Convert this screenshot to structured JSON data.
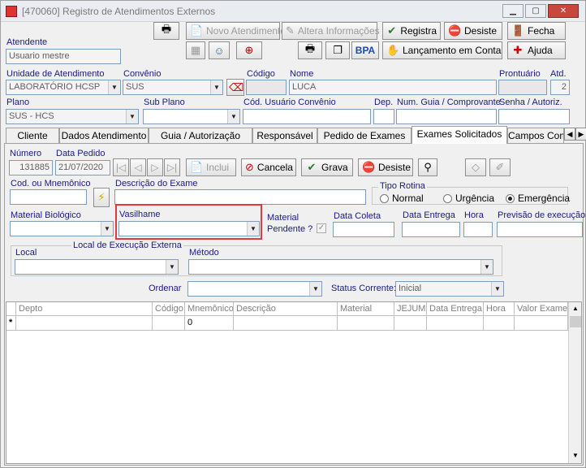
{
  "window": {
    "title": "[470060]   Registro de Atendimentos Externos",
    "min_glyph": "▁",
    "max_glyph": "▢",
    "close_glyph": "✕"
  },
  "toolbar": {
    "novo_atendimento": "Novo Atendimento",
    "altera_informacoes": "Altera Informações",
    "registra": "Registra",
    "desiste": "Desiste",
    "fecha": "Fecha",
    "bpa": "BPA",
    "lancamento_em_conta": "Lançamento em Conta",
    "ajuda": "Ajuda"
  },
  "header": {
    "atendente_label": "Atendente",
    "atendente_value": "Usuario mestre",
    "unidade_label": "Unidade de Atendimento",
    "unidade_value": "LABORATÓRIO HCSP",
    "convenio_label": "Convênio",
    "convenio_value": "SUS",
    "codigo_label": "Código",
    "nome_label": "Nome",
    "nome_value": "LUCA",
    "prontuario_label": "Prontuário",
    "atd_label": "Atd.",
    "atd_value": "2",
    "plano_label": "Plano",
    "plano_value": "SUS - HCS",
    "subplano_label": "Sub Plano",
    "cod_usuario_label": "Cód. Usuário Convênio",
    "dep_label": "Dep.",
    "num_guia_label": "Num. Guia / Comprovante",
    "senha_label": "Senha / Autoriz."
  },
  "tabs": [
    {
      "label": "Cliente"
    },
    {
      "label": "Dados Atendimento"
    },
    {
      "label": "Guia / Autorização"
    },
    {
      "label": "Responsável"
    },
    {
      "label": "Pedido de Exames"
    },
    {
      "label": "Exames Solicitados"
    },
    {
      "label": "Campos Com"
    }
  ],
  "exames": {
    "numero_label": "Número",
    "numero_value": "131885",
    "data_pedido_label": "Data Pedido",
    "data_pedido_value": "21/07/2020",
    "inclui": "Inclui",
    "cancela": "Cancela",
    "grava": "Grava",
    "desiste": "Desiste",
    "cod_mnemonico_label": "Cod. ou Mnemônico",
    "descricao_label": "Descrição do Exame",
    "tipo_rotina_label": "Tipo Rotina",
    "rotina_normal": "Normal",
    "rotina_urgencia": "Urgência",
    "rotina_emergencia": "Emergência",
    "material_biologico_label": "Material Biológico",
    "vasilhame_label": "Vasilhame",
    "material_pendente_label_1": "Material",
    "material_pendente_label_2": "Pendente ?",
    "data_coleta_label": "Data Coleta",
    "data_entrega_label": "Data Entrega",
    "hora_label": "Hora",
    "previsao_label": "Previsão de execução",
    "local_execucao_label": "Local de Execução Externa",
    "local_label": "Local",
    "metodo_label": "Método",
    "ordenar_label": "Ordenar",
    "status_corrente_label": "Status Corrente:",
    "status_corrente_value": "Inicial"
  },
  "grid": {
    "columns": [
      "Depto",
      "Código",
      "Mnemônico",
      "Descrição",
      "Material",
      "JEJUM",
      "Data Entrega",
      "Hora",
      "Valor Exame"
    ],
    "row_marker": "*",
    "row_mnemonico": "0"
  },
  "colors": {
    "highlight": "#e03a3a",
    "label_blue": "#1a1a80"
  }
}
